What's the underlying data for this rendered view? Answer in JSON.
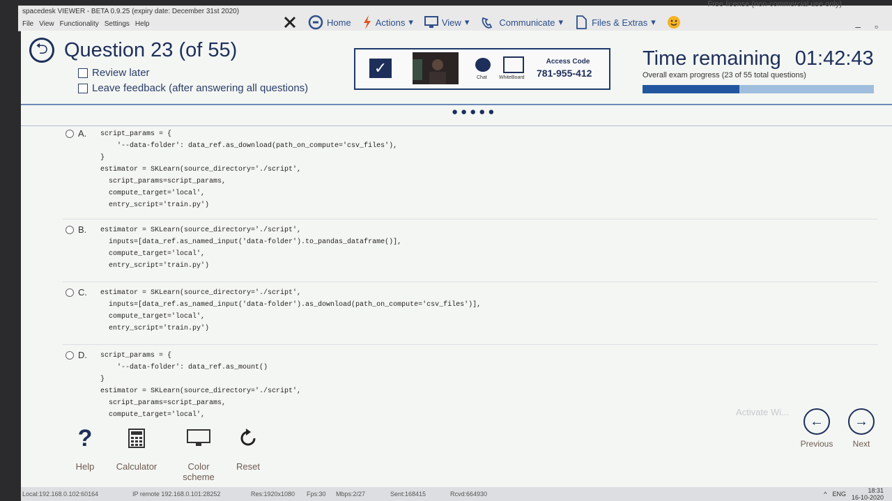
{
  "app": {
    "title": "spacedesk VIEWER - BETA 0.9.25 (expiry date: December 31st 2020)",
    "menu": [
      "File",
      "View",
      "Functionality",
      "Settings",
      "Help"
    ],
    "license": "Free license (non-commercial use only)"
  },
  "toolbar": {
    "home": "Home",
    "actions": "Actions",
    "view": "View",
    "communicate": "Communicate",
    "files": "Files & Extras"
  },
  "question": {
    "title": "Question 23 (of 55)",
    "review_later": "Review later",
    "leave_feedback": "Leave feedback (after answering all questions)"
  },
  "panel": {
    "chat_label": "Chat",
    "whiteboard_label": "WhiteBoard",
    "access_label": "Access Code",
    "access_code": "781-955-412"
  },
  "timer": {
    "label": "Time remaining",
    "value": "01:42:43",
    "progress_label": "Overall exam progress (23 of 55 total questions)",
    "progress_fraction": 0.418
  },
  "options": [
    {
      "letter": "A.",
      "code": "script_params = {\n    '--data-folder': data_ref.as_download(path_on_compute='csv_files'),\n}\nestimator = SKLearn(source_directory='./script',\n  script_params=script_params,\n  compute_target='local',\n  entry_script='train.py')"
    },
    {
      "letter": "B.",
      "code": "estimator = SKLearn(source_directory='./script',\n  inputs=[data_ref.as_named_input('data-folder').to_pandas_dataframe()],\n  compute_target='local',\n  entry_script='train.py')"
    },
    {
      "letter": "C.",
      "code": "estimator = SKLearn(source_directory='./script',\n  inputs=[data_ref.as_named_input('data-folder').as_download(path_on_compute='csv_files')],\n  compute_target='local',\n  entry_script='train.py')"
    },
    {
      "letter": "D.",
      "code": "script_params = {\n    '--data-folder': data_ref.as_mount()\n}\nestimator = SKLearn(source_directory='./script',\n  script_params=script_params,\n  compute_target='local',"
    }
  ],
  "tools": {
    "help": "Help",
    "calculator": "Calculator",
    "color_scheme": "Color scheme",
    "reset": "Reset"
  },
  "nav": {
    "previous": "Previous",
    "next": "Next",
    "watermark": "Activate Wi..."
  },
  "status": {
    "ip_local": "Local:192.168.0.102:60164",
    "ip_remote": "IP remote 192.168.0.101:28252",
    "res": "Res:1920x1080",
    "fps": "Fps:30",
    "mbps": "Mbps:2/27",
    "sent": "Sent:168415",
    "recvd": "Rcvd:664930",
    "lang": "ENG",
    "time": "18:31",
    "date": "16-10-2020"
  },
  "colors": {
    "navy": "#1d2f5a",
    "progress_fill": "#2257a0",
    "progress_track": "#9fbede"
  }
}
